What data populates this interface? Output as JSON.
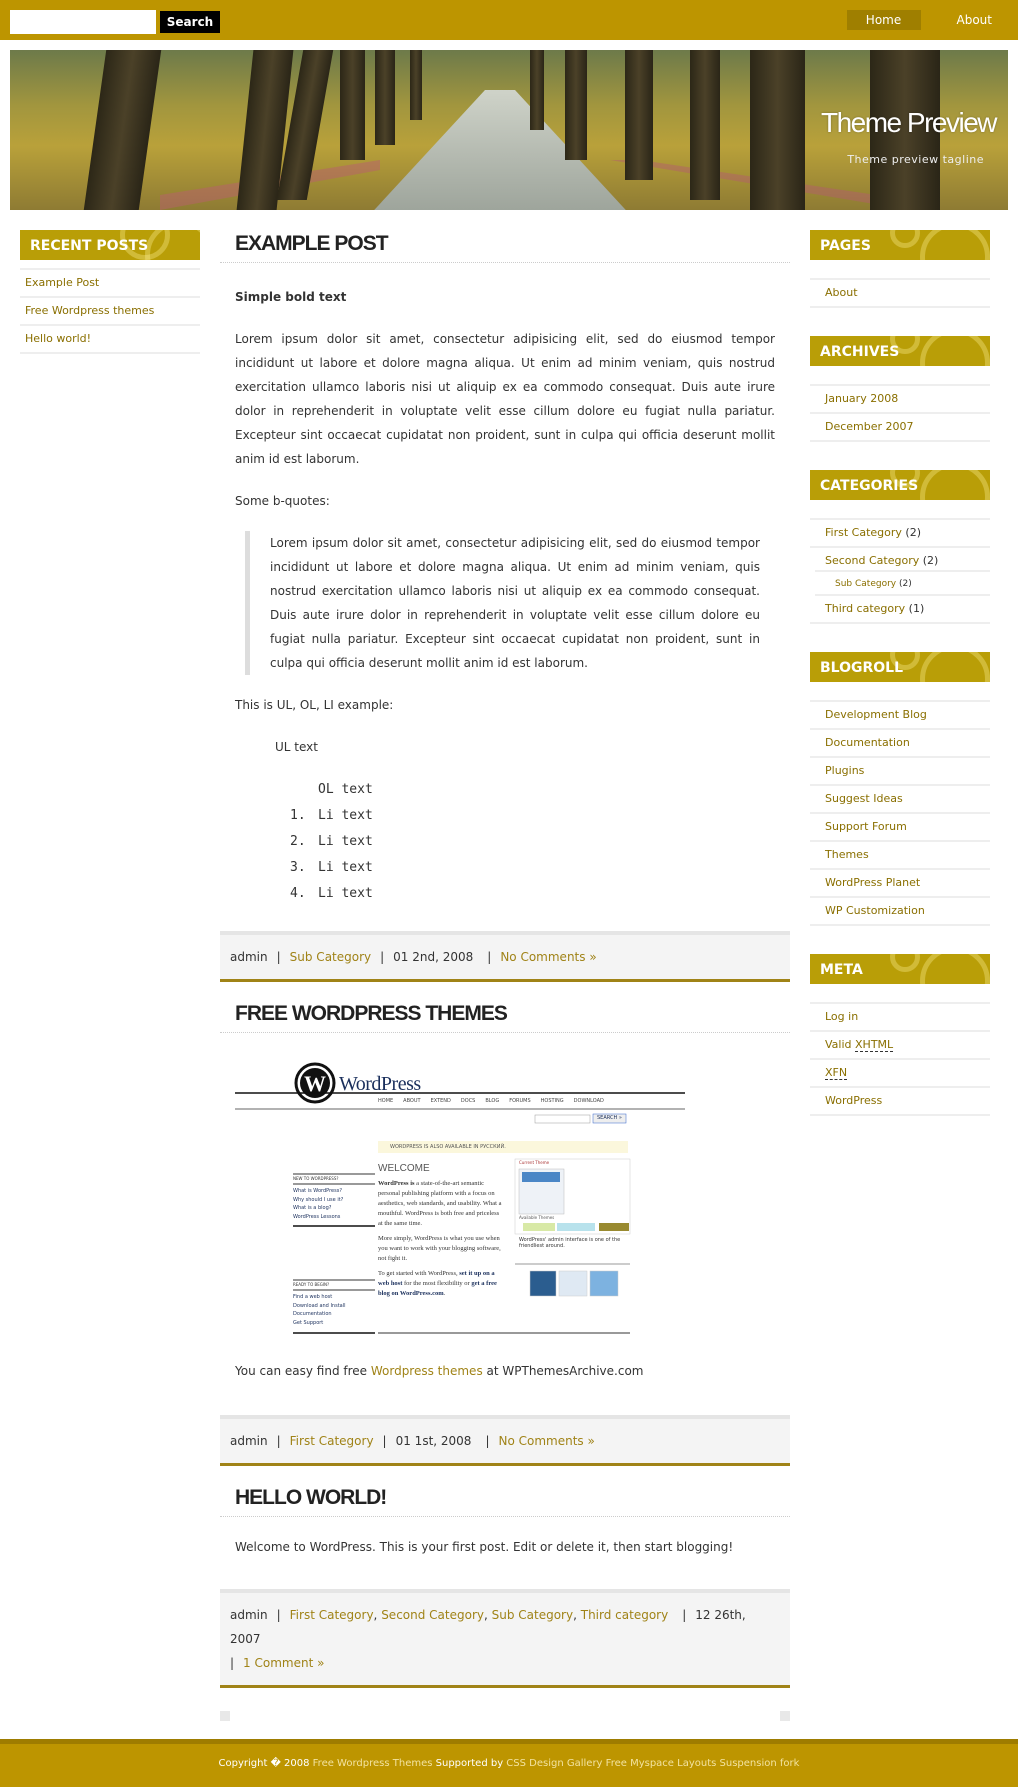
{
  "topbar": {
    "search_placeholder": "",
    "search_button": "Search",
    "nav": [
      {
        "label": "Home",
        "active": true
      },
      {
        "label": "About",
        "active": false
      }
    ]
  },
  "header": {
    "title": "Theme Preview",
    "tagline": "Theme preview tagline"
  },
  "left_sidebar": {
    "title": "RECENT POSTS",
    "items": [
      "Example Post",
      "Free Wordpress themes",
      "Hello world!"
    ]
  },
  "right_sidebar": {
    "pages": {
      "title": "PAGES",
      "items": [
        "About"
      ]
    },
    "archives": {
      "title": "ARCHIVES",
      "items": [
        "January 2008",
        "December 2007"
      ]
    },
    "categories": {
      "title": "CATEGORIES",
      "items": [
        {
          "label": "First Category",
          "count": "(2)"
        },
        {
          "label": "Second Category",
          "count": "(2)"
        },
        {
          "label": "Sub Category",
          "count": "(2)",
          "sub": true
        },
        {
          "label": "Third category",
          "count": "(1)"
        }
      ]
    },
    "blogroll": {
      "title": "BLOGROLL",
      "items": [
        "Development Blog",
        "Documentation",
        "Plugins",
        "Suggest Ideas",
        "Support Forum",
        "Themes",
        "WordPress Planet",
        "WP Customization"
      ]
    },
    "meta": {
      "title": "META",
      "items": [
        {
          "prefix": "Log in",
          "abbr": ""
        },
        {
          "prefix": "Valid ",
          "abbr": "XHTML"
        },
        {
          "prefix": "",
          "abbr": "XFN"
        },
        {
          "prefix": "WordPress",
          "abbr": ""
        }
      ]
    }
  },
  "posts": [
    {
      "title": "EXAMPLE POST",
      "bold": "Simple bold text",
      "paragraph": "Lorem ipsum dolor sit amet, consectetur adipisicing elit, sed do eiusmod tempor incididunt ut labore et dolore magna aliqua. Ut enim ad minim veniam, quis nostrud exercitation ullamco laboris nisi ut aliquip ex ea commodo consequat. Duis aute irure dolor in reprehenderit in voluptate velit esse cillum dolore eu fugiat nulla pariatur. Excepteur sint occaecat cupidatat non proident, sunt in culpa qui officia deserunt mollit anim id est laborum.",
      "bq_intro": "Some b-quotes:",
      "blockquote": "Lorem ipsum dolor sit amet, consectetur adipisicing elit, sed do eiusmod tempor incididunt ut labore et dolore magna aliqua. Ut enim ad minim veniam, quis nostrud exercitation ullamco laboris nisi ut aliquip ex ea commodo consequat. Duis aute irure dolor in reprehenderit in voluptate velit esse cillum dolore eu fugiat nulla pariatur. Excepteur sint occaecat cupidatat non proident, sunt in culpa qui officia deserunt mollit anim id est laborum.",
      "list_intro": "This is UL, OL, LI example:",
      "ul_text": "UL text",
      "ol_text": "OL text",
      "li_items": [
        "Li text",
        "Li text",
        "Li text",
        "Li text"
      ],
      "meta": {
        "author": "admin",
        "categories": [
          "Sub Category"
        ],
        "date": "01 2nd, 2008",
        "comments": "No Comments »"
      }
    },
    {
      "title": "FREE WORDPRESS THEMES",
      "screenshot": {
        "logo": "WordPress",
        "nav": [
          "HOME",
          "ABOUT",
          "EXTEND",
          "DOCS",
          "BLOG",
          "FORUMS",
          "HOSTING",
          "DOWNLOAD"
        ],
        "search": "SEARCH »",
        "notice": "WORDPRESS IS ALSO AVAILABLE IN РУССКИЙ.",
        "welcome": "WELCOME",
        "new_heading": "NEW TO WORDPRESS?",
        "new_links": [
          "What is WordPress?",
          "Why should I use it?",
          "What is a blog?",
          "WordPress Lessons"
        ],
        "ready_heading": "READY TO BEGIN?",
        "ready_links": [
          "Find a web host",
          "Download and Install",
          "Documentation",
          "Get Support"
        ],
        "para1_bold": "WordPress is",
        "para1": " a state-of-the-art semantic personal publishing platform with a focus on aesthetics, web standards, and usability. What a mouthful. WordPress is both free and priceless at the same time.",
        "para2": "More simply, WordPress is what you use when you want to work with your blogging software, not fight it.",
        "para3_a": "To get started with WordPress, ",
        "para3_link1": "set it up on a web host",
        "para3_b": " for the most flexibility or ",
        "para3_link2": "get a free blog on WordPress.com",
        "current_theme": "Current Theme",
        "available_themes": "Available Themes",
        "caption": "WordPress' admin interface is one of the friendliest around."
      },
      "text_before": "You can easy find free ",
      "text_link": "Wordpress themes",
      "text_after": " at WPThemesArchive.com",
      "meta": {
        "author": "admin",
        "categories": [
          "First Category"
        ],
        "date": "01 1st, 2008",
        "comments": "No Comments »"
      }
    },
    {
      "title": "HELLO WORLD!",
      "paragraph": "Welcome to WordPress. This is your first post. Edit or delete it, then start blogging!",
      "meta": {
        "author": "admin",
        "categories": [
          "First Category",
          "Second Category",
          "Sub Category",
          "Third category"
        ],
        "date": "12 26th, 2007",
        "comments": "1 Comment »"
      }
    }
  ],
  "footer": {
    "copyright": "Copyright � 2008 ",
    "link1": "Free Wordpress Themes",
    "supported": " Supported by ",
    "link2": "CSS Design Gallery",
    "link3": "Free Myspace Layouts",
    "link4": "Suspension fork"
  },
  "colors": {
    "brand": "#bd9500",
    "brand_dark": "#9e7c00",
    "link": "#a08317",
    "widget_title": "#b99e07"
  }
}
